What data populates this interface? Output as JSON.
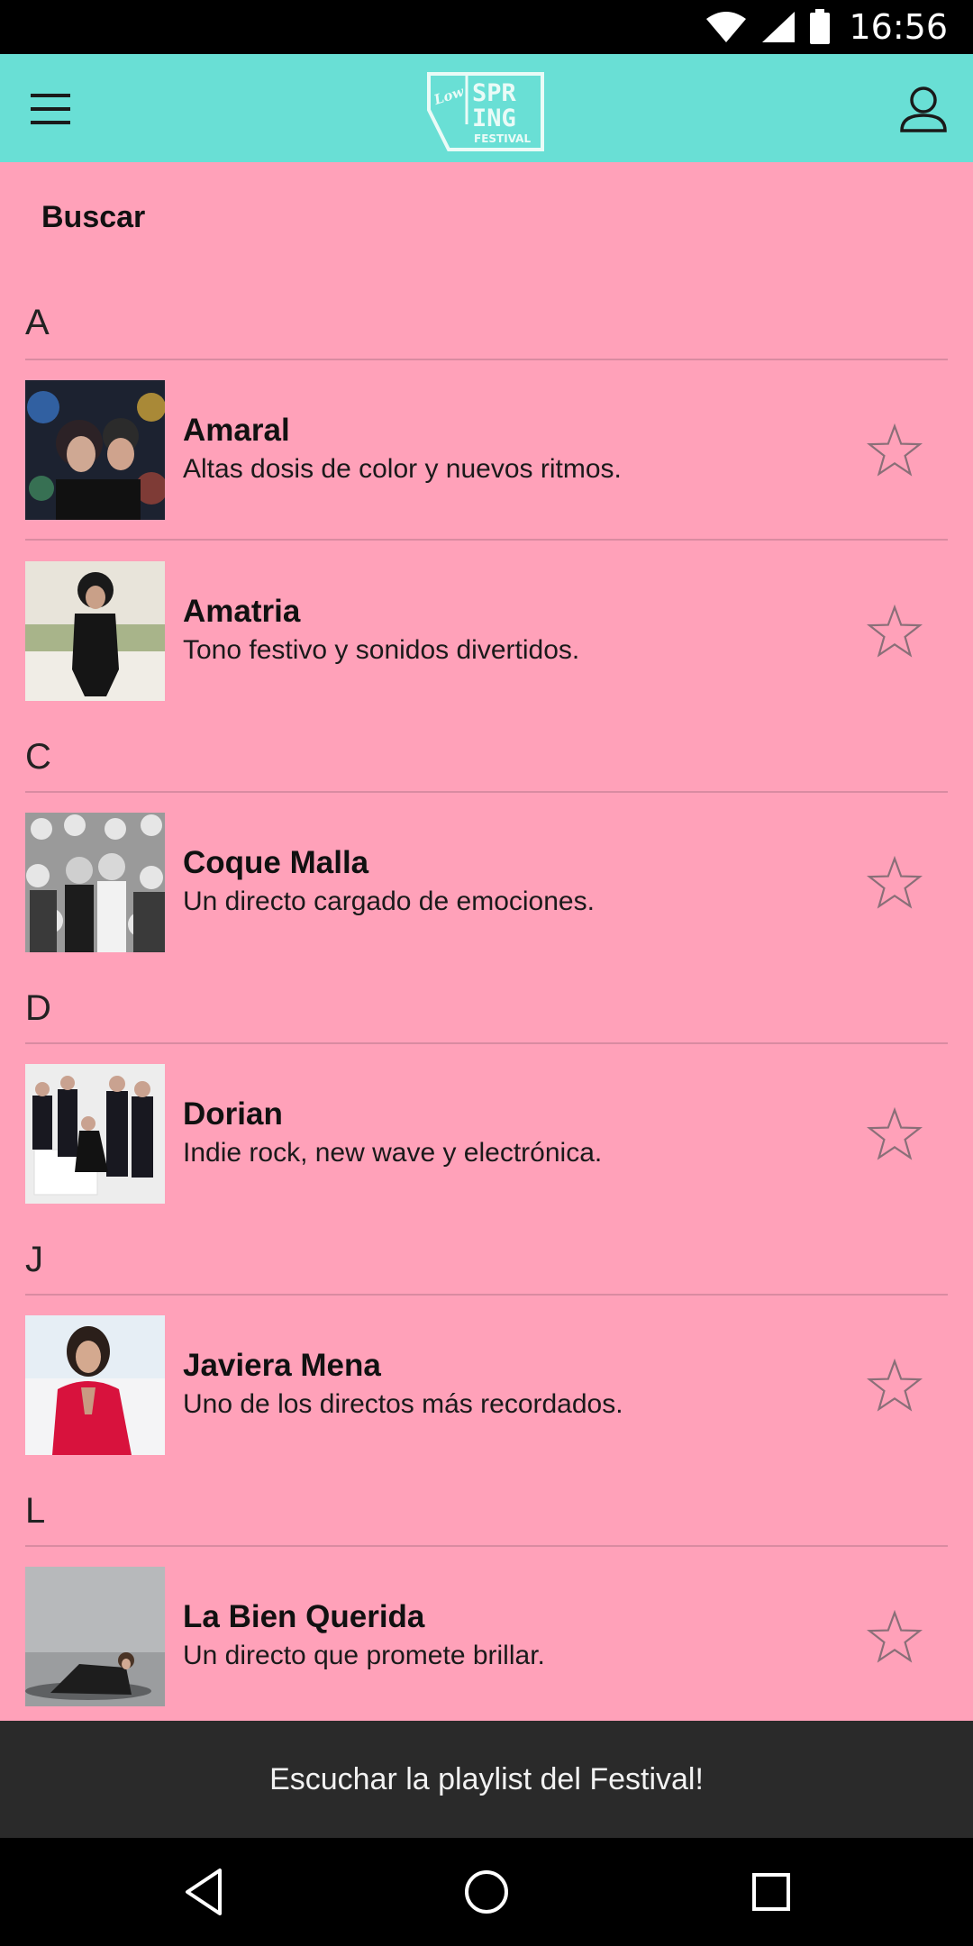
{
  "status_bar": {
    "time": "16:56",
    "icons": [
      "wifi-icon",
      "signal-icon",
      "battery-icon"
    ]
  },
  "app_bar": {
    "menu_icon": "hamburger-menu-icon",
    "logo": {
      "script_text": "Low",
      "line1": "SPR",
      "line2": "ING",
      "line3": "FESTIVAL"
    },
    "profile_icon": "user-profile-icon"
  },
  "search": {
    "label": "Buscar"
  },
  "sections": [
    {
      "letter": "A",
      "artists": [
        {
          "name": "Amaral",
          "description": "Altas dosis de color y nuevos ritmos."
        },
        {
          "name": "Amatria",
          "description": "Tono festivo y sonidos divertidos."
        }
      ]
    },
    {
      "letter": "C",
      "artists": [
        {
          "name": "Coque Malla",
          "description": "Un directo cargado de emociones."
        }
      ]
    },
    {
      "letter": "D",
      "artists": [
        {
          "name": "Dorian",
          "description": "Indie rock, new wave y electrónica."
        }
      ]
    },
    {
      "letter": "J",
      "artists": [
        {
          "name": "Javiera Mena",
          "description": "Uno de los directos más recordados."
        }
      ]
    },
    {
      "letter": "L",
      "artists": [
        {
          "name": "La Bien Querida",
          "description": "Un directo que promete brillar."
        }
      ]
    }
  ],
  "bottom_banner": {
    "label": "Escuchar la playlist del Festival!"
  },
  "nav_bar": {
    "icons": [
      "back-icon",
      "home-icon",
      "recents-icon"
    ]
  },
  "colors": {
    "background": "#ffa1b9",
    "app_bar": "#69dfd5",
    "banner": "#2a2a2a",
    "star_outline": "#8a6f78"
  }
}
